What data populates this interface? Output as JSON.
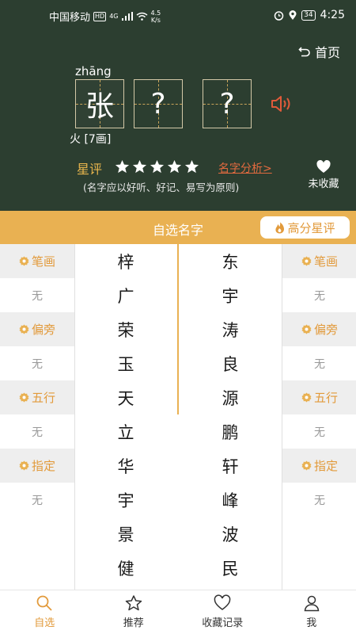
{
  "status_bar": {
    "carrier": "中国移动",
    "hd": "HD",
    "network": "4G",
    "speed_value": "4.5",
    "speed_unit": "K/s",
    "battery": "34",
    "time": "4:25"
  },
  "header": {
    "home_label": "首页",
    "pinyin": "zhāng",
    "chars": [
      "张",
      "?",
      "?"
    ],
    "element_info": "火 [7画]",
    "rating_label": "星评",
    "rating_stars": 5,
    "analysis_link": "名字分析>",
    "principle": "(名字应以好听、好记、易写为原则)",
    "favorite_label": "未收藏"
  },
  "orange_bar": {
    "title": "自选名字",
    "high_score_label": "高分星评"
  },
  "filters_left": [
    {
      "label": "笔画",
      "value": "无"
    },
    {
      "label": "偏旁",
      "value": "无"
    },
    {
      "label": "五行",
      "value": "无"
    },
    {
      "label": "指定",
      "value": "无"
    }
  ],
  "filters_right": [
    {
      "label": "笔画",
      "value": "无"
    },
    {
      "label": "偏旁",
      "value": "无"
    },
    {
      "label": "五行",
      "value": "无"
    },
    {
      "label": "指定",
      "value": "无"
    }
  ],
  "names_left": [
    "梓",
    "广",
    "荣",
    "玉",
    "天",
    "立",
    "华",
    "宇",
    "景",
    "健"
  ],
  "names_right": [
    "东",
    "宇",
    "涛",
    "良",
    "源",
    "鹏",
    "轩",
    "峰",
    "波",
    "民"
  ],
  "bottom_nav": [
    {
      "label": "自选",
      "icon": "search-icon",
      "active": true
    },
    {
      "label": "推荐",
      "icon": "star-icon",
      "active": false
    },
    {
      "label": "收藏记录",
      "icon": "heart-icon",
      "active": false
    },
    {
      "label": "我",
      "icon": "user-icon",
      "active": false
    }
  ],
  "colors": {
    "board": "#2c3e30",
    "accent": "#e9b152",
    "link": "#e26a3f"
  }
}
